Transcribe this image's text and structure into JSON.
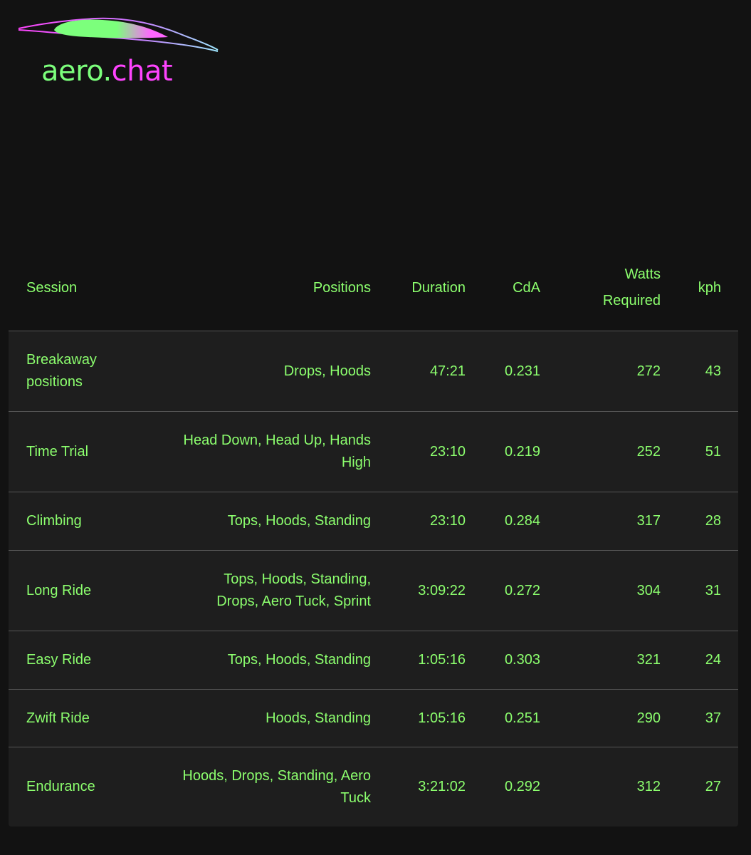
{
  "brand": {
    "name_part1": "aero.",
    "name_part2": "chat",
    "colors": {
      "green": "#7cff7c",
      "magenta": "#ff44ff",
      "cyan": "#9fe8ff"
    }
  },
  "table": {
    "headers": {
      "session": "Session",
      "positions": "Positions",
      "duration": "Duration",
      "cda": "CdA",
      "watts": "Watts Required",
      "kph": "kph"
    },
    "rows": [
      {
        "session": "Breakaway positions",
        "positions": "Drops, Hoods",
        "duration": "47:21",
        "cda": "0.231",
        "watts": "272",
        "kph": "43"
      },
      {
        "session": "Time Trial",
        "positions": "Head Down, Head Up, Hands High",
        "duration": "23:10",
        "cda": "0.219",
        "watts": "252",
        "kph": "51"
      },
      {
        "session": "Climbing",
        "positions": "Tops, Hoods, Standing",
        "duration": "23:10",
        "cda": "0.284",
        "watts": "317",
        "kph": "28"
      },
      {
        "session": "Long Ride",
        "positions": "Tops, Hoods, Standing, Drops, Aero Tuck, Sprint",
        "duration": "3:09:22",
        "cda": "0.272",
        "watts": "304",
        "kph": "31"
      },
      {
        "session": "Easy Ride",
        "positions": "Tops, Hoods, Standing",
        "duration": "1:05:16",
        "cda": "0.303",
        "watts": "321",
        "kph": "24"
      },
      {
        "session": "Zwift Ride",
        "positions": "Hoods, Standing",
        "duration": "1:05:16",
        "cda": "0.251",
        "watts": "290",
        "kph": "37"
      },
      {
        "session": "Endurance",
        "positions": "Hoods, Drops, Standing, Aero Tuck",
        "duration": "3:21:02",
        "cda": "0.292",
        "watts": "312",
        "kph": "27"
      }
    ]
  }
}
